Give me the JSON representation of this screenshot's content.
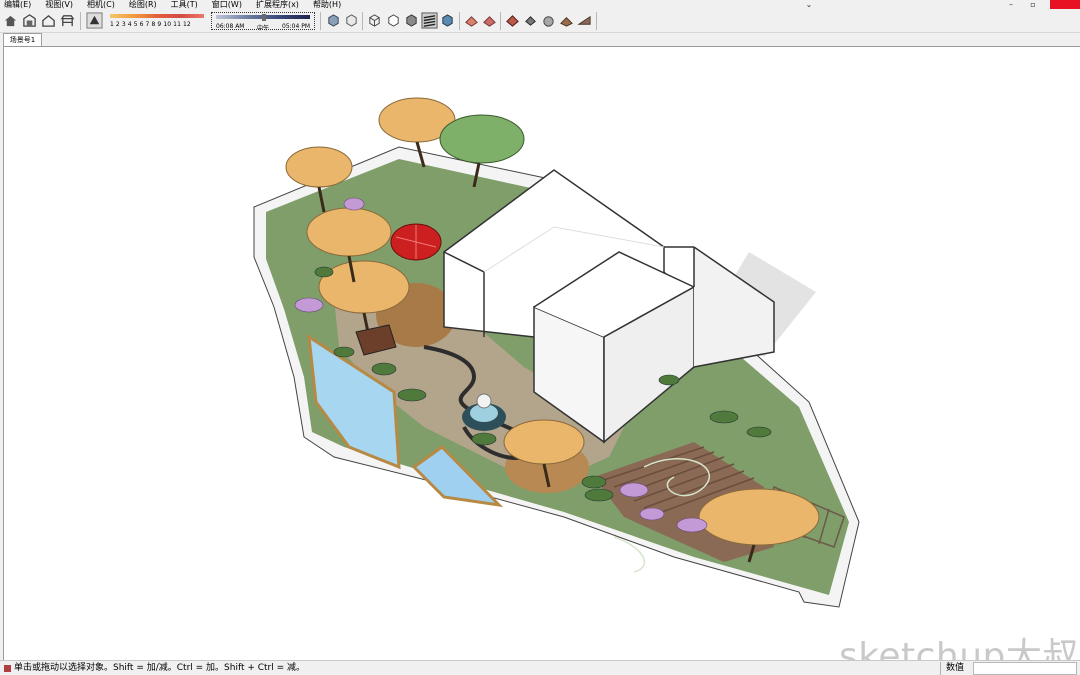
{
  "menu": {
    "items": [
      "编辑(E)",
      "视图(V)",
      "相机(C)",
      "绘图(R)",
      "工具(T)",
      "窗口(W)",
      "扩展程序(x)",
      "帮助(H)"
    ]
  },
  "shadow_toolbar": {
    "scale_numbers": "1 2 3 4 5 6 7 8 9 10 11 12",
    "time_start": "06:08 AM",
    "time_mid": "中午",
    "time_end": "05:04 PM"
  },
  "scene_tabs": [
    "场景号1"
  ],
  "viewport": {
    "watermark": "sketchup大叔"
  },
  "status": {
    "message": "单击或拖动以选择对象。Shift = 加/减。Ctrl = 加。Shift + Ctrl = 减。",
    "value_label": "数值",
    "value": ""
  },
  "colors": {
    "close_button": "#e81123",
    "lawn": "#7f9e6a",
    "paving": "#b3a48c",
    "deck": "#8a6a55",
    "tree_orange": "#e9b66b",
    "tree_green": "#7fb06a",
    "water": "#a7d6f0",
    "umbrella": "#cc1f1f"
  },
  "icons": [
    "home-icon",
    "warehouse-icon",
    "house-icon",
    "gazebo-icon",
    "shadow-toggle-icon",
    "style-xray-icon",
    "style-backedges-icon",
    "style-wireframe-icon",
    "style-hiddenline-icon",
    "style-shaded-icon",
    "style-textured-icon",
    "style-monochrome-icon",
    "sandbox-icon",
    "section-icon",
    "component-icon",
    "paint-icon",
    "extension-icon",
    "cursor-icon"
  ]
}
